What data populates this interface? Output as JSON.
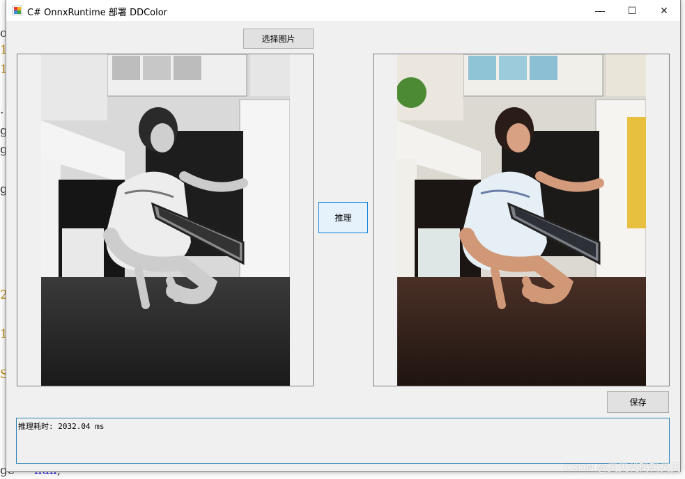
{
  "window": {
    "title": "C# OnnxRuntime 部署 DDColor",
    "minimize": "—",
    "maximize": "☐",
    "close": "✕"
  },
  "buttons": {
    "select_image": "选择图片",
    "infer": "推理",
    "save": "保存"
  },
  "output_text": "推理耗时: 2032.04 ms",
  "background_code": {
    "lines": [
      "o",
      "1",
      "1",
      ".",
      "g",
      "g",
      "g",
      "2",
      "1",
      "S"
    ],
    "last_line_prefix": "ge",
    "last_line_keyword": "null",
    "last_line_suffix": ";"
  },
  "watermark": "CSDN @天天代码码天天"
}
